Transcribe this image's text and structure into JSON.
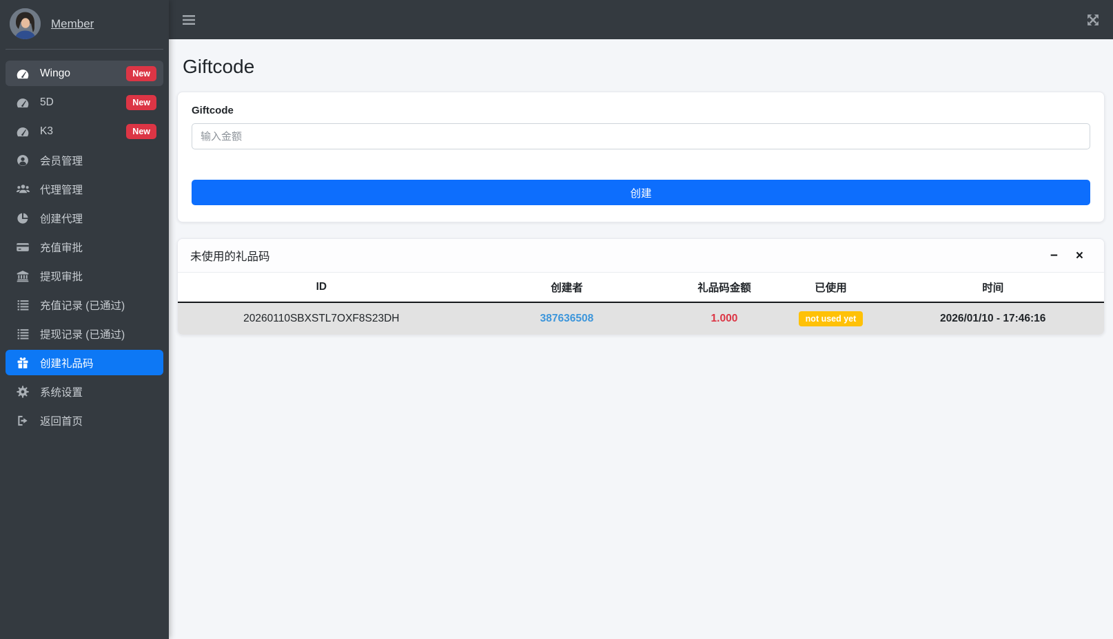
{
  "sidebar": {
    "profile": {
      "name": "Member"
    },
    "items": [
      {
        "label": "Wingo",
        "badge": "New",
        "icon": "tachometer-icon",
        "state": "hover"
      },
      {
        "label": "5D",
        "badge": "New",
        "icon": "tachometer-icon",
        "state": "normal"
      },
      {
        "label": "K3",
        "badge": "New",
        "icon": "tachometer-icon",
        "state": "normal"
      },
      {
        "label": "会员管理",
        "icon": "user-circle-icon",
        "state": "normal"
      },
      {
        "label": "代理管理",
        "icon": "users-icon",
        "state": "normal"
      },
      {
        "label": "创建代理",
        "icon": "pie-chart-icon",
        "state": "normal"
      },
      {
        "label": "充值审批",
        "icon": "credit-card-icon",
        "state": "normal"
      },
      {
        "label": "提现审批",
        "icon": "bank-icon",
        "state": "normal"
      },
      {
        "label": "充值记录 (已通过)",
        "icon": "list-icon",
        "state": "normal"
      },
      {
        "label": "提现记录 (已通过)",
        "icon": "list-icon",
        "state": "normal"
      },
      {
        "label": "创建礼品码",
        "icon": "gift-icon",
        "state": "active"
      },
      {
        "label": "系统设置",
        "icon": "gear-icon",
        "state": "normal"
      },
      {
        "label": "返回首页",
        "icon": "signout-icon",
        "state": "normal"
      }
    ]
  },
  "page": {
    "title": "Giftcode"
  },
  "form": {
    "label": "Giftcode",
    "input_value": "",
    "input_placeholder": "输入金额",
    "submit_label": "创建"
  },
  "table_card": {
    "title": "未使用的礼品码",
    "tools": {
      "minimize_label": "−",
      "close_label": "×"
    },
    "columns": [
      "ID",
      "创建者",
      "礼品码金额",
      "已使用",
      "时间"
    ],
    "rows": [
      {
        "id": "20260110SBXSTL7OXF8S23DH",
        "creator": "387636508",
        "amount": "1.000",
        "used_label": "not used yet",
        "time": "2026/01/10 - 17:46:16"
      }
    ]
  },
  "colors": {
    "sidebar_bg": "#343a40",
    "navbar_bg": "#343a40",
    "active_item_blue": "#0d78f5",
    "primary_button_blue": "#0d6efd",
    "badge_red": "#dc3545",
    "amount_red": "#dc3545",
    "creator_link_blue": "#3d96db",
    "warning_badge_yellow": "#ffc107",
    "content_bg": "#f4f6f9",
    "row_bg": "#e2e2e2"
  }
}
